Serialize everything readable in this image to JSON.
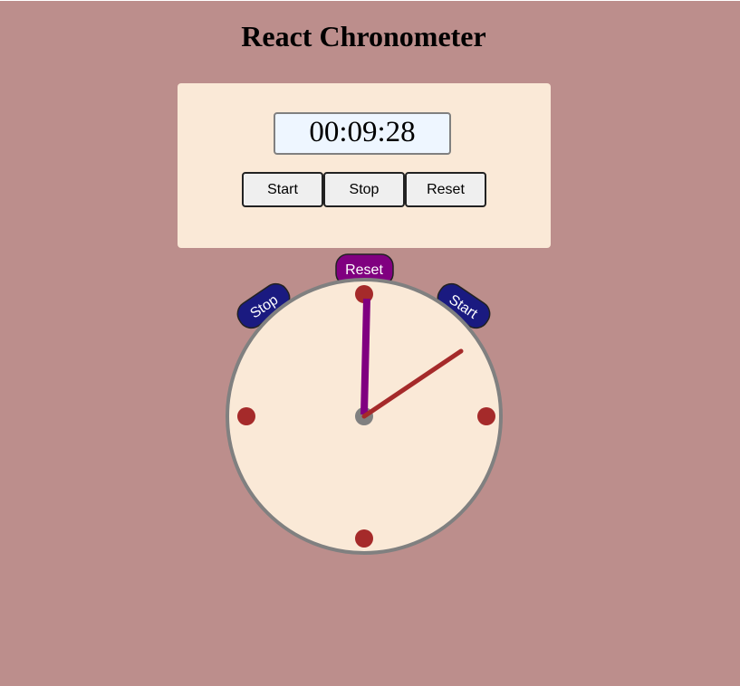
{
  "app": {
    "title": "React Chronometer"
  },
  "timer": {
    "display": "00:09:28"
  },
  "controls": {
    "start_label": "Start",
    "stop_label": "Stop",
    "reset_label": "Reset"
  },
  "clock": {
    "reset_label": "Reset",
    "stop_label": "Stop",
    "start_label": "Start"
  },
  "colors": {
    "background": "#bc8e8c",
    "panel": "#fae9d7",
    "display_bg": "#eef6ff",
    "hand_minute": "#800080",
    "hand_second": "#a52a2a",
    "marker": "#a52a2a",
    "side_button": "#1a1a80",
    "top_button": "#800080",
    "dial_border": "#808080"
  }
}
